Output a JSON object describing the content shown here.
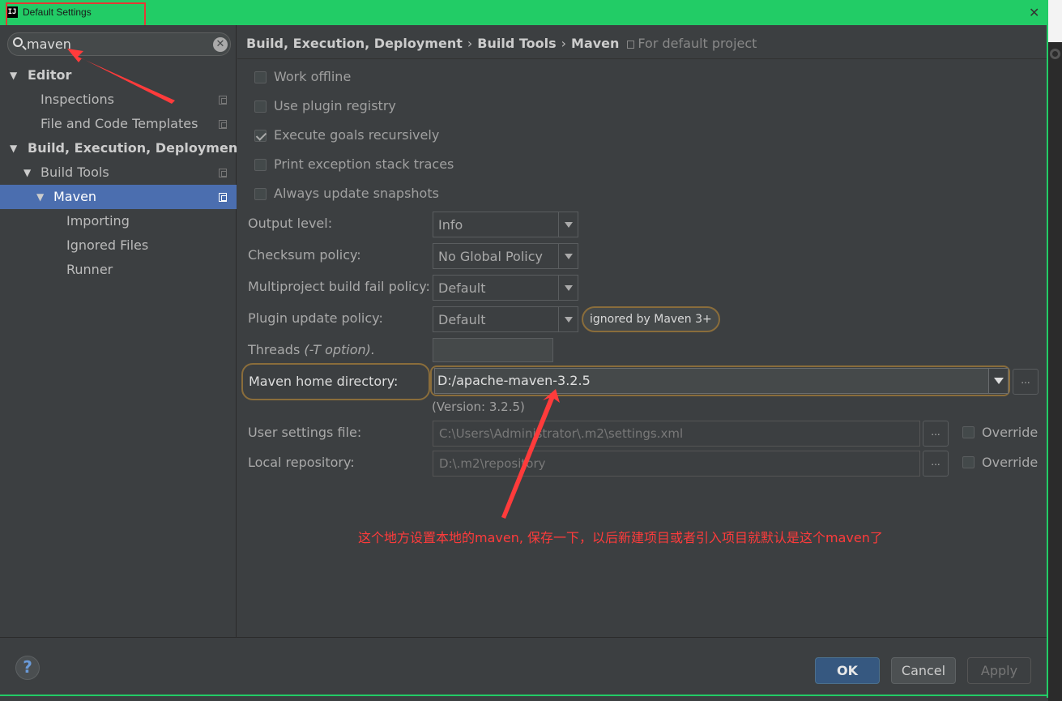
{
  "window": {
    "title": "Default Settings",
    "app_icon": "IJ",
    "close_label": "✕"
  },
  "sidebar": {
    "search": {
      "value": "maven",
      "clear_label": "✕"
    },
    "items": [
      {
        "label": "Editor",
        "level": 0,
        "expanded": true,
        "bold": true
      },
      {
        "label": "Inspections",
        "level": 1,
        "scoped": true
      },
      {
        "label": "File and Code Templates",
        "level": 1,
        "scoped": true
      },
      {
        "label": "Build, Execution, Deployment",
        "level": 0,
        "expanded": true,
        "bold": true
      },
      {
        "label": "Build Tools",
        "level": 1,
        "expanded": true,
        "scoped": true
      },
      {
        "label": "Maven",
        "level": 2,
        "expanded": true,
        "selected": true,
        "scoped": true
      },
      {
        "label": "Importing",
        "level": 3
      },
      {
        "label": "Ignored Files",
        "level": 3
      },
      {
        "label": "Runner",
        "level": 3
      }
    ]
  },
  "breadcrumb": {
    "crumbs": [
      "Build, Execution, Deployment",
      "Build Tools",
      "Maven"
    ],
    "separator": "›",
    "scope": "For default project"
  },
  "options": {
    "work_offline": {
      "label": "Work offline",
      "checked": false
    },
    "use_plugin_registry": {
      "label": "Use plugin registry",
      "checked": false
    },
    "execute_goals_recursively": {
      "label": "Execute goals recursively",
      "checked": true
    },
    "print_exception_stack_traces": {
      "label": "Print exception stack traces",
      "checked": false
    },
    "always_update_snapshots": {
      "label": "Always update snapshots",
      "checked": false
    }
  },
  "fields": {
    "output_level": {
      "label": "Output level:",
      "value": "Info"
    },
    "checksum_policy": {
      "label": "Checksum policy:",
      "value": "No Global Policy"
    },
    "multiproject_fail_policy": {
      "label": "Multiproject build fail policy:",
      "value": "Default"
    },
    "plugin_update_policy": {
      "label": "Plugin update policy:",
      "value": "Default",
      "badge": "ignored by Maven 3+"
    },
    "threads": {
      "label": "Threads",
      "hint": "(-T option).",
      "value": ""
    },
    "maven_home": {
      "label": "Maven home directory:",
      "value": "D:/apache-maven-3.2.5",
      "version": "(Version: 3.2.5)"
    },
    "user_settings": {
      "label": "User settings file:",
      "value": "C:\\Users\\Administrator\\.m2\\settings.xml",
      "override_label": "Override",
      "override_checked": false
    },
    "local_repository": {
      "label": "Local repository:",
      "value": "D:\\.m2\\repository",
      "override_label": "Override",
      "override_checked": false
    },
    "browse_label": "..."
  },
  "annotation": {
    "text": "这个地方设置本地的maven, 保存一下，以后新建项目或者引入项目就默认是这个maven了",
    "color": "#ff3b3b"
  },
  "footer": {
    "help_label": "?",
    "ok_label": "OK",
    "cancel_label": "Cancel",
    "apply_label": "Apply"
  },
  "colors": {
    "titlebar": "#22cc66",
    "selection": "#4b6eaf",
    "background": "#3c3f41",
    "highlight_outline": "#8a6d3b",
    "annotation_red": "#ff3b3b"
  }
}
